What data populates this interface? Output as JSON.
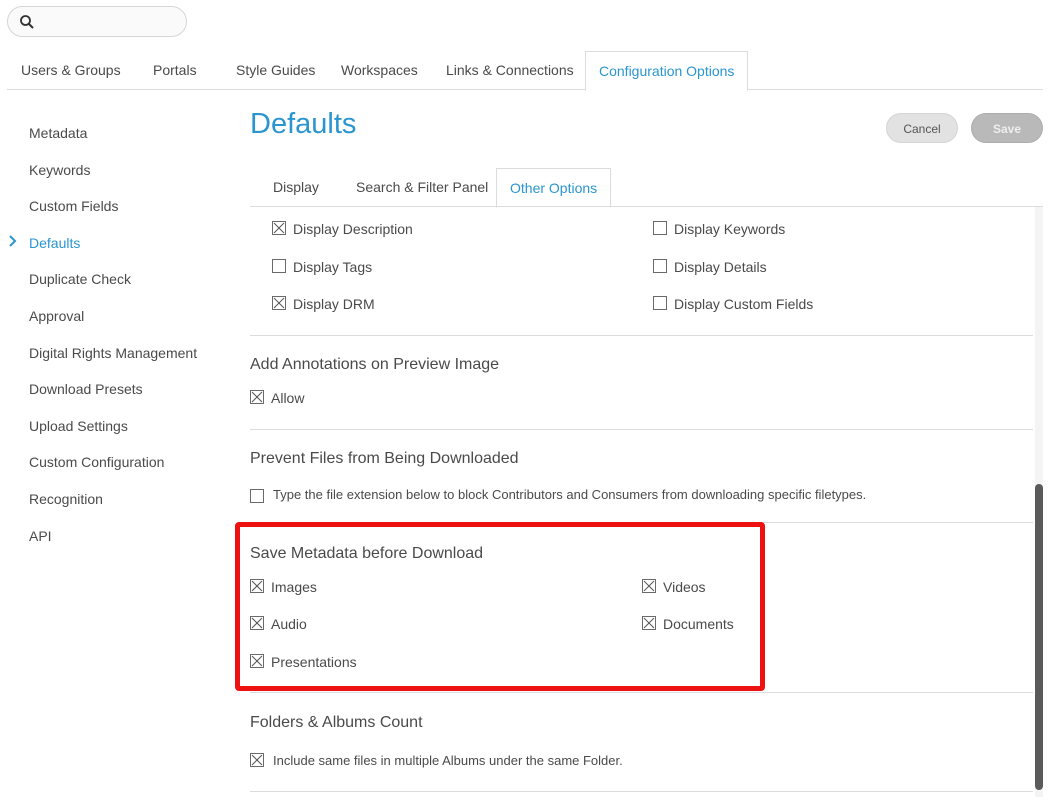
{
  "search": {
    "placeholder": ""
  },
  "top_tabs": [
    {
      "label": "Users & Groups"
    },
    {
      "label": "Portals"
    },
    {
      "label": "Style Guides"
    },
    {
      "label": "Workspaces"
    },
    {
      "label": "Links & Connections"
    },
    {
      "label": "Configuration Options",
      "active": true
    }
  ],
  "sidebar": {
    "items": [
      {
        "label": "Metadata"
      },
      {
        "label": "Keywords"
      },
      {
        "label": "Custom Fields"
      },
      {
        "label": "Defaults",
        "active": true
      },
      {
        "label": "Duplicate Check"
      },
      {
        "label": "Approval"
      },
      {
        "label": "Digital Rights Management"
      },
      {
        "label": "Download Presets"
      },
      {
        "label": "Upload Settings"
      },
      {
        "label": "Custom Configuration"
      },
      {
        "label": "Recognition"
      },
      {
        "label": "API"
      }
    ]
  },
  "page": {
    "title": "Defaults",
    "cancel_label": "Cancel",
    "save_label": "Save"
  },
  "sub_tabs": [
    {
      "label": "Display"
    },
    {
      "label": "Search & Filter Panel"
    },
    {
      "label": "Other Options",
      "active": true
    }
  ],
  "display_options": [
    {
      "label": "Display Description",
      "checked": true
    },
    {
      "label": "Display Keywords",
      "checked": false
    },
    {
      "label": "Display Tags",
      "checked": false
    },
    {
      "label": "Display Details",
      "checked": false
    },
    {
      "label": "Display DRM",
      "checked": true
    },
    {
      "label": "Display Custom Fields",
      "checked": false
    }
  ],
  "annotations": {
    "title": "Add Annotations on Preview Image",
    "allow_label": "Allow",
    "allow_checked": true
  },
  "prevent_download": {
    "title": "Prevent Files from Being Downloaded",
    "option_label": "Type the file extension below to block Contributors and Consumers from downloading specific filetypes.",
    "option_checked": false
  },
  "save_metadata": {
    "title": "Save Metadata before Download",
    "options": [
      {
        "label": "Images",
        "checked": true
      },
      {
        "label": "Videos",
        "checked": true
      },
      {
        "label": "Audio",
        "checked": true
      },
      {
        "label": "Documents",
        "checked": true
      },
      {
        "label": "Presentations",
        "checked": true
      }
    ]
  },
  "folders_albums": {
    "title": "Folders & Albums Count",
    "option_label": "Include same files in multiple Albums under the same Folder.",
    "option_checked": true
  },
  "colors": {
    "accent": "#2a95cf",
    "highlight": "#ee1111",
    "text": "#4a4a4a"
  }
}
